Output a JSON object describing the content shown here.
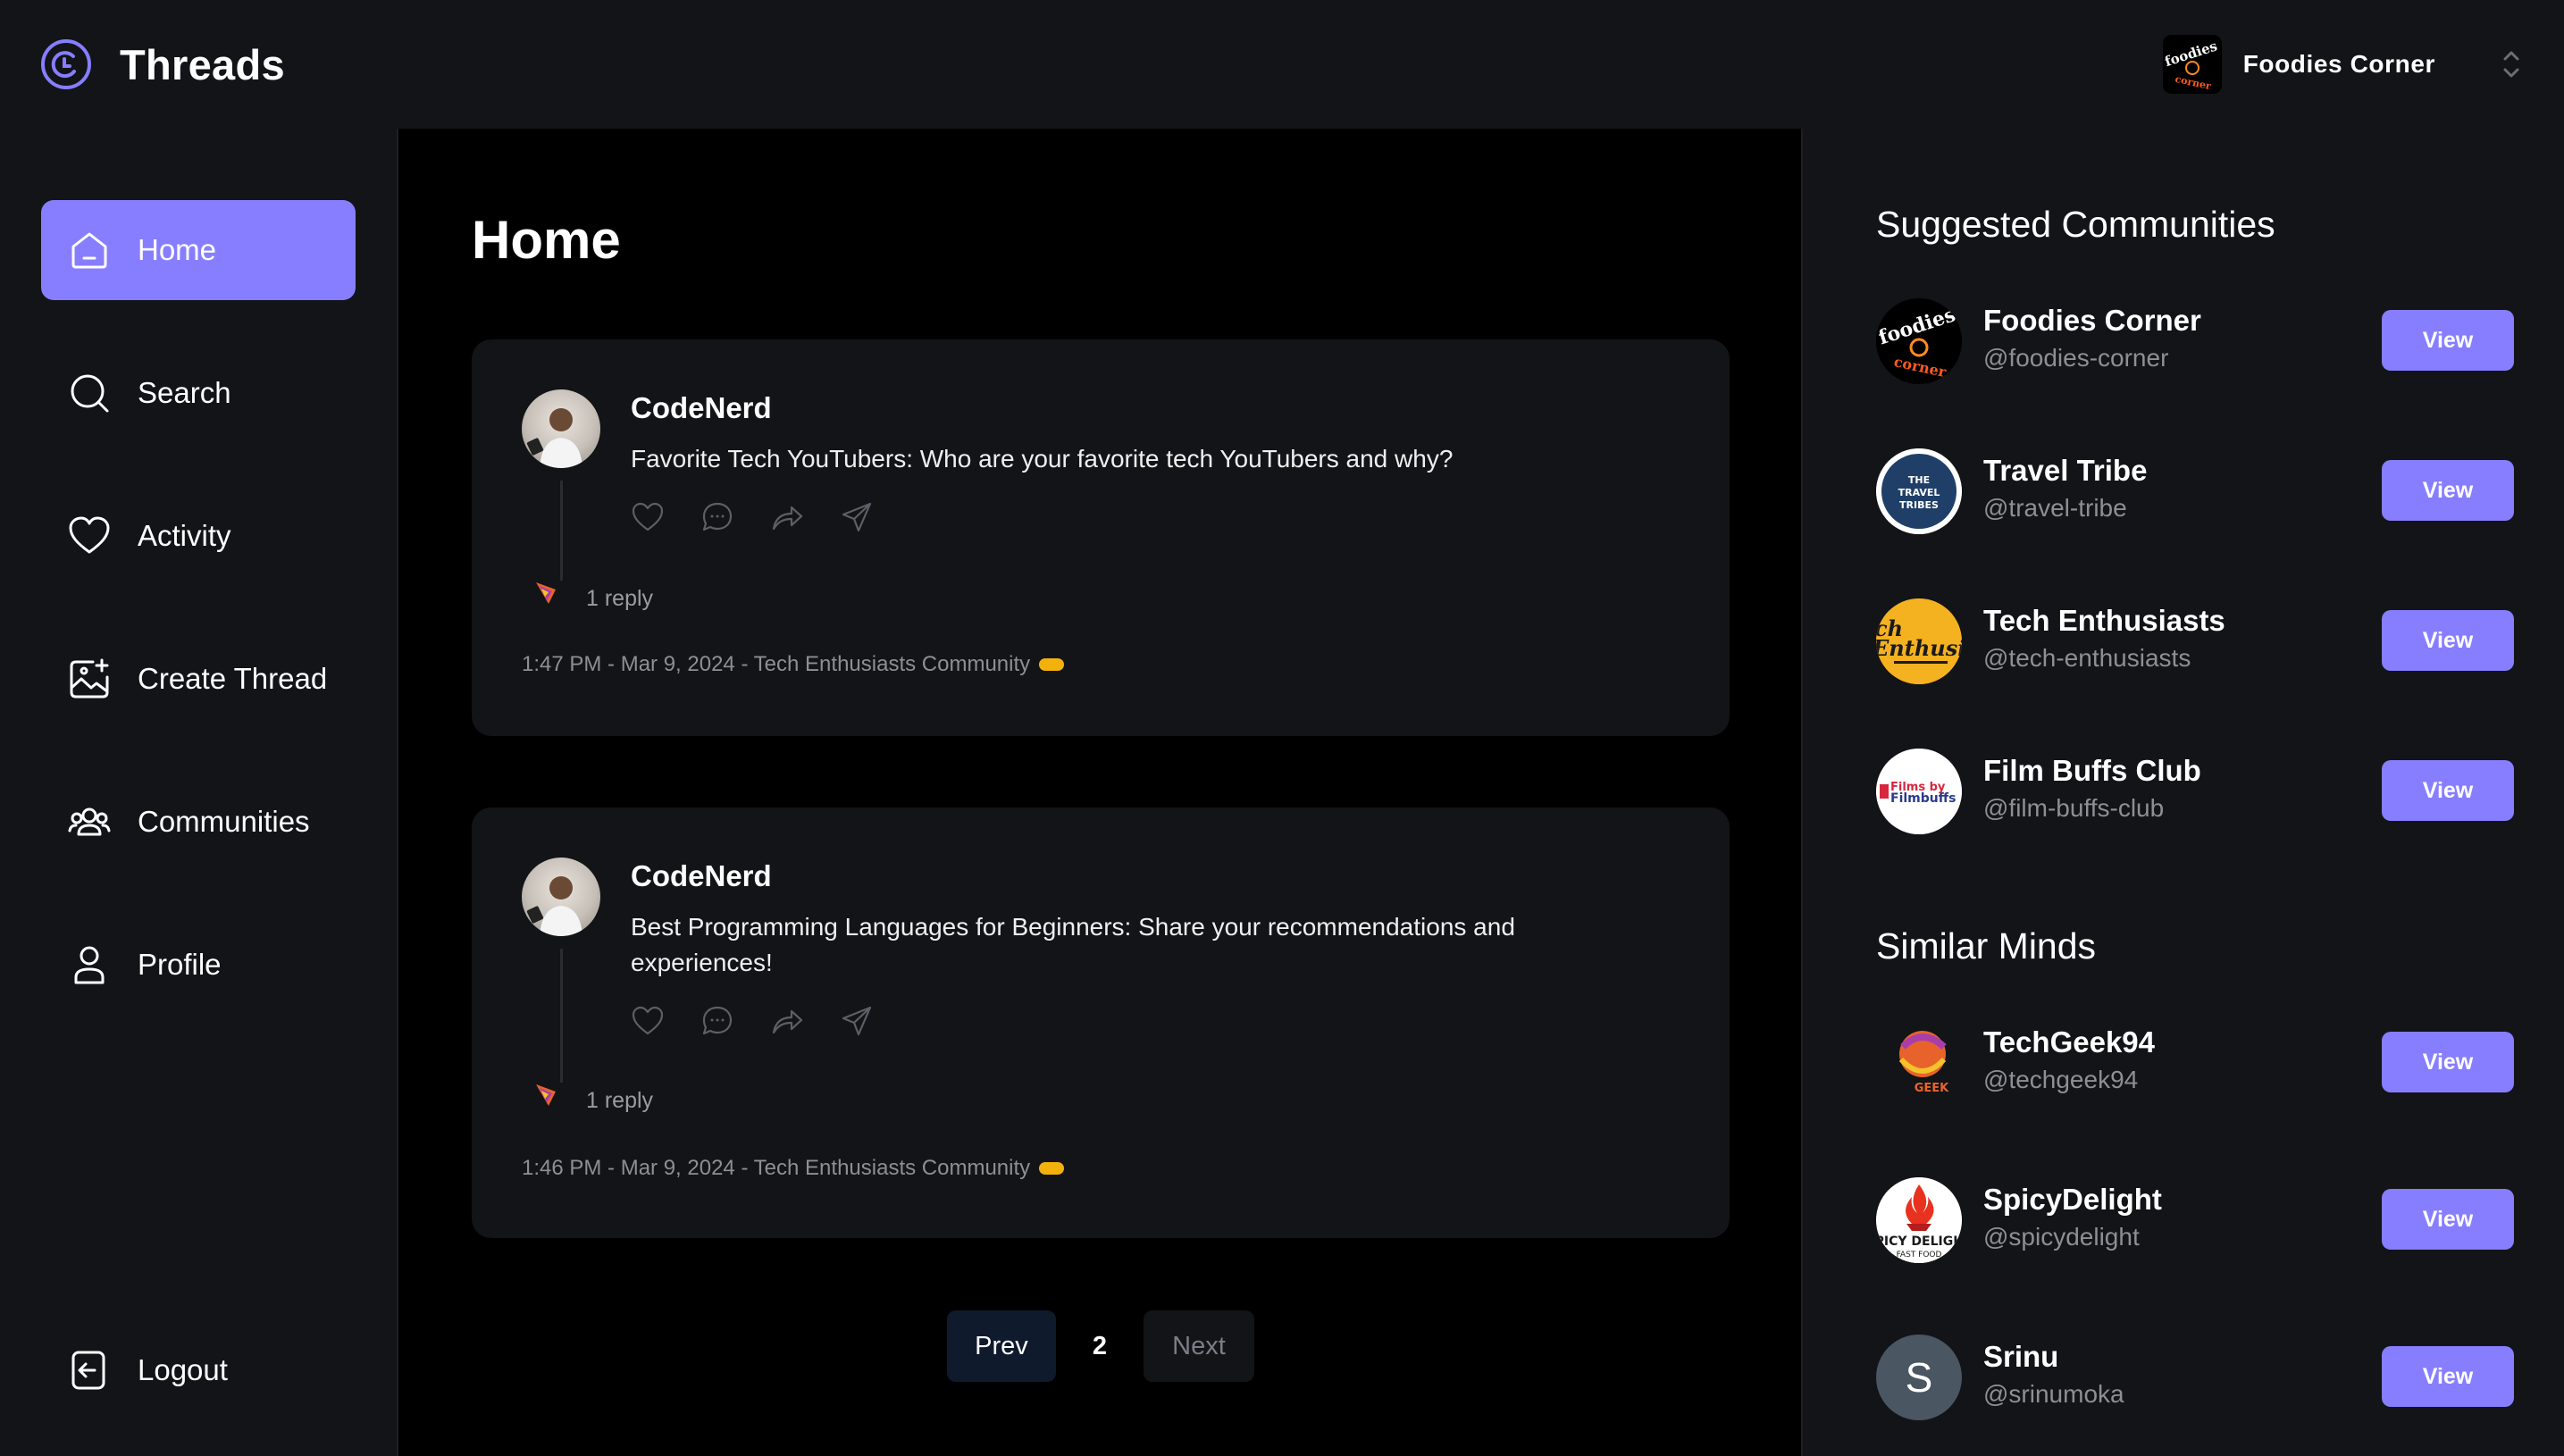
{
  "app": {
    "name": "Threads",
    "brand_color": "#877eff"
  },
  "account": {
    "name": "Foodies Corner",
    "avatar_text": "foodies corner"
  },
  "sidebar": {
    "items": [
      {
        "label": "Home",
        "icon": "home-icon",
        "active": true
      },
      {
        "label": "Search",
        "icon": "search-icon",
        "active": false
      },
      {
        "label": "Activity",
        "icon": "heart-icon",
        "active": false
      },
      {
        "label": "Create Thread",
        "icon": "image-plus-icon",
        "active": false
      },
      {
        "label": "Communities",
        "icon": "users-icon",
        "active": false
      },
      {
        "label": "Profile",
        "icon": "user-icon",
        "active": false
      }
    ],
    "logout_label": "Logout"
  },
  "main": {
    "title": "Home",
    "threads": [
      {
        "author": "CodeNerd",
        "text": "Favorite Tech YouTubers: Who are your favorite tech YouTubers and why?",
        "replies": "1 reply",
        "meta": "1:47 PM - Mar 9, 2024 - Tech Enthusiasts Community"
      },
      {
        "author": "CodeNerd",
        "text": "Best Programming Languages for Beginners: Share your recommendations and experiences!",
        "replies": "1 reply",
        "meta": "1:46 PM - Mar 9, 2024 - Tech Enthusiasts Community"
      }
    ],
    "pagination": {
      "prev_label": "Prev",
      "current_page": "2",
      "next_label": "Next"
    }
  },
  "right": {
    "communities_title": "Suggested Communities",
    "communities": [
      {
        "name": "Foodies Corner",
        "handle": "@foodies-corner",
        "avatar_text": "foodies",
        "view_label": "View"
      },
      {
        "name": "Travel Tribe",
        "handle": "@travel-tribe",
        "avatar_text": "THE TRAVEL TRIBES",
        "view_label": "View"
      },
      {
        "name": "Tech Enthusiasts",
        "handle": "@tech-enthusiasts",
        "avatar_text": "ch Enthusia",
        "view_label": "View"
      },
      {
        "name": "Film Buffs Club",
        "handle": "@film-buffs-club",
        "avatar_text": "Films by Filmbuffs",
        "view_label": "View"
      }
    ],
    "users_title": "Similar Minds",
    "users": [
      {
        "name": "TechGeek94",
        "handle": "@techgeek94",
        "avatar_text": "GEEK",
        "view_label": "View"
      },
      {
        "name": "SpicyDelight",
        "handle": "@spicydelight",
        "avatar_text": "SPICY DELIGHT",
        "view_label": "View"
      },
      {
        "name": "Srinu",
        "handle": "@srinumoka",
        "avatar_text": "S",
        "view_label": "View"
      }
    ]
  }
}
